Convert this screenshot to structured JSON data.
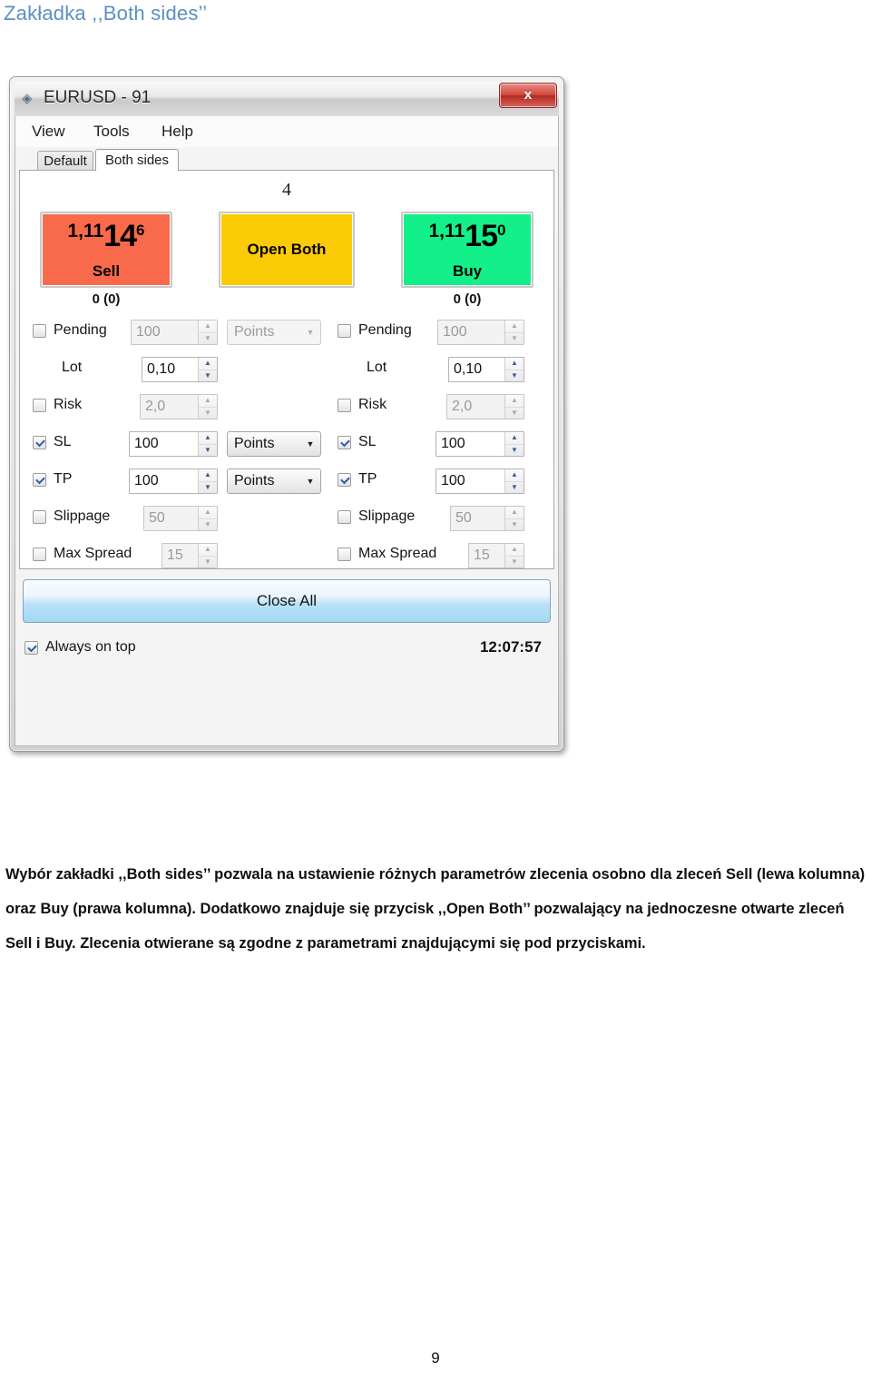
{
  "document": {
    "heading": "Zakładka ,,Both sides’’",
    "body_text": "Wybór zakładki ,,Both sides’’ pozwala na ustawienie różnych parametrów zlecenia osobno dla  zleceń Sell (lewa kolumna) oraz Buy (prawa kolumna). Dodatkowo znajduje się przycisk ,,Open Both’’ pozwalający na jednoczesne otwarte zleceń Sell i Buy. Zlecenia otwierane są zgodne z parametrami znajdującymi się pod przyciskami.",
    "page_number": "9"
  },
  "window": {
    "title": "EURUSD - 91",
    "icon": "app-logo-icon",
    "close_label": "x",
    "menu": [
      {
        "label": "View"
      },
      {
        "label": "Tools"
      },
      {
        "label": "Help"
      }
    ],
    "tabs": [
      {
        "label": "Default",
        "active": false
      },
      {
        "label": "Both sides",
        "active": true
      }
    ]
  },
  "trade": {
    "spread": "4",
    "sell": {
      "price_pre": "1,11",
      "price_big": "14",
      "price_post": "6",
      "side_label": "Sell",
      "positions": "0 (0)",
      "color": "#F86A4B"
    },
    "buy": {
      "price_pre": "1,11",
      "price_big": "15",
      "price_post": "0",
      "side_label": "Buy",
      "positions": "0 (0)",
      "color": "#13F08A"
    },
    "open_both": {
      "label": "Open Both",
      "color": "#FBCB06"
    }
  },
  "left_column": {
    "rows": [
      {
        "label": "Pending",
        "checkbox": true,
        "checked": false,
        "value": "100",
        "enabled": false,
        "unit": "Points",
        "has_unit": true
      },
      {
        "label": "Lot",
        "checkbox": false,
        "checked": false,
        "value": "0,10",
        "enabled": true,
        "unit": "",
        "has_unit": false
      },
      {
        "label": "Risk",
        "checkbox": true,
        "checked": false,
        "value": "2,0",
        "enabled": false,
        "unit": "",
        "has_unit": false
      },
      {
        "label": "SL",
        "checkbox": true,
        "checked": true,
        "value": "100",
        "enabled": true,
        "unit": "Points",
        "has_unit": true
      },
      {
        "label": "TP",
        "checkbox": true,
        "checked": true,
        "value": "100",
        "enabled": true,
        "unit": "Points",
        "has_unit": true
      },
      {
        "label": "Slippage",
        "checkbox": true,
        "checked": false,
        "value": "50",
        "enabled": false,
        "unit": "",
        "has_unit": false
      },
      {
        "label": "Max Spread",
        "checkbox": true,
        "checked": false,
        "value": "15",
        "enabled": false,
        "unit": "",
        "has_unit": false
      }
    ]
  },
  "right_column": {
    "rows": [
      {
        "label": "Pending",
        "checkbox": true,
        "checked": false,
        "value": "100",
        "enabled": false
      },
      {
        "label": "Lot",
        "checkbox": false,
        "checked": false,
        "value": "0,10",
        "enabled": true
      },
      {
        "label": "Risk",
        "checkbox": true,
        "checked": false,
        "value": "2,0",
        "enabled": false
      },
      {
        "label": "SL",
        "checkbox": true,
        "checked": true,
        "value": "100",
        "enabled": true
      },
      {
        "label": "TP",
        "checkbox": true,
        "checked": true,
        "value": "100",
        "enabled": true
      },
      {
        "label": "Slippage",
        "checkbox": true,
        "checked": false,
        "value": "50",
        "enabled": false
      },
      {
        "label": "Max Spread",
        "checkbox": true,
        "checked": false,
        "value": "15",
        "enabled": false
      }
    ]
  },
  "footer": {
    "close_all_label": "Close All",
    "always_on_top_label": "Always on top",
    "always_on_top_checked": true,
    "clock": "12:07:57"
  },
  "spinner": {
    "up": "▲",
    "down": "▼"
  },
  "dropdown_arrow": "▼"
}
